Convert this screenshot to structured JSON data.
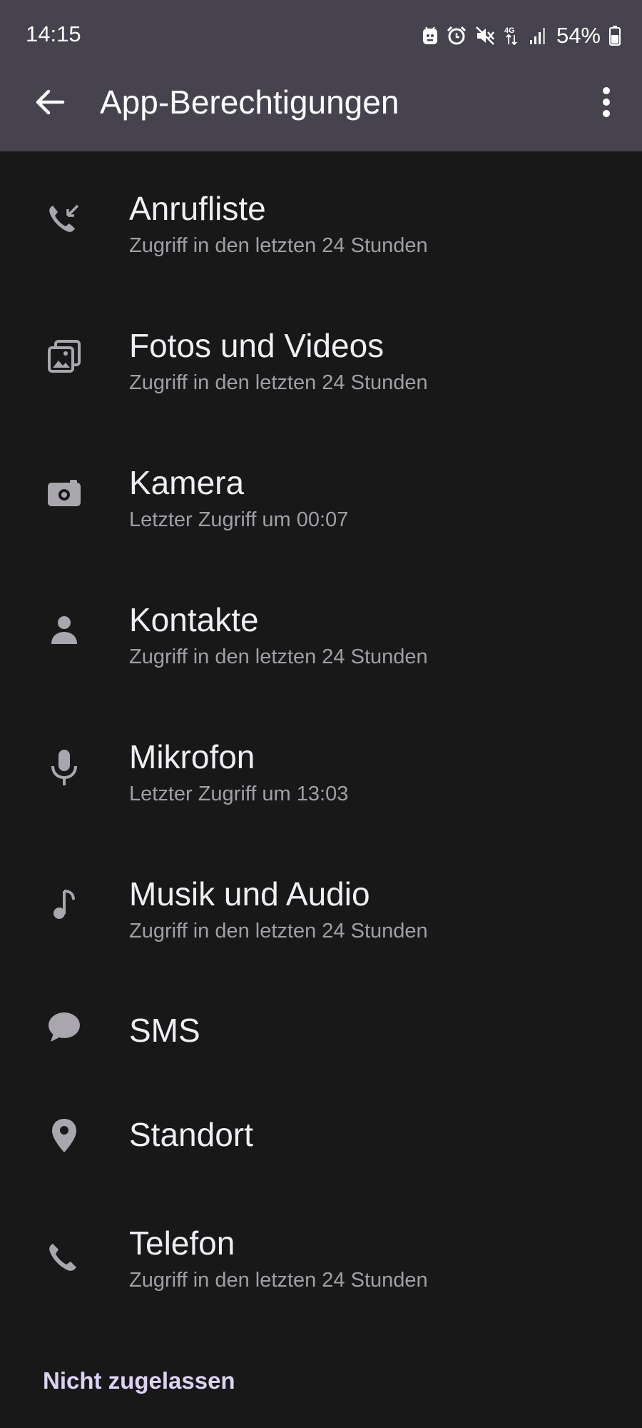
{
  "status_bar": {
    "time": "14:15",
    "battery": "54%",
    "network": "4G"
  },
  "header": {
    "title": "App-Berechtigungen"
  },
  "permissions": [
    {
      "label": "Anrufliste",
      "subtitle": "Zugriff in den letzten 24 Stunden",
      "icon": "call-log-icon"
    },
    {
      "label": "Fotos und Videos",
      "subtitle": "Zugriff in den letzten 24 Stunden",
      "icon": "photos-icon"
    },
    {
      "label": "Kamera",
      "subtitle": "Letzter Zugriff um 00:07",
      "icon": "camera-icon"
    },
    {
      "label": "Kontakte",
      "subtitle": "Zugriff in den letzten 24 Stunden",
      "icon": "contacts-icon"
    },
    {
      "label": "Mikrofon",
      "subtitle": "Letzter Zugriff um 13:03",
      "icon": "microphone-icon"
    },
    {
      "label": "Musik und Audio",
      "subtitle": "Zugriff in den letzten 24 Stunden",
      "icon": "music-icon"
    },
    {
      "label": "SMS",
      "subtitle": "",
      "icon": "sms-icon"
    },
    {
      "label": "Standort",
      "subtitle": "",
      "icon": "location-icon"
    },
    {
      "label": "Telefon",
      "subtitle": "Zugriff in den letzten 24 Stunden",
      "icon": "phone-icon"
    }
  ],
  "section": {
    "not_allowed": "Nicht zugelassen"
  },
  "colors": {
    "app_bar": "#46434e",
    "background": "#191819",
    "icon": "#a9a7ad",
    "section_header": "#dcd3f3"
  }
}
